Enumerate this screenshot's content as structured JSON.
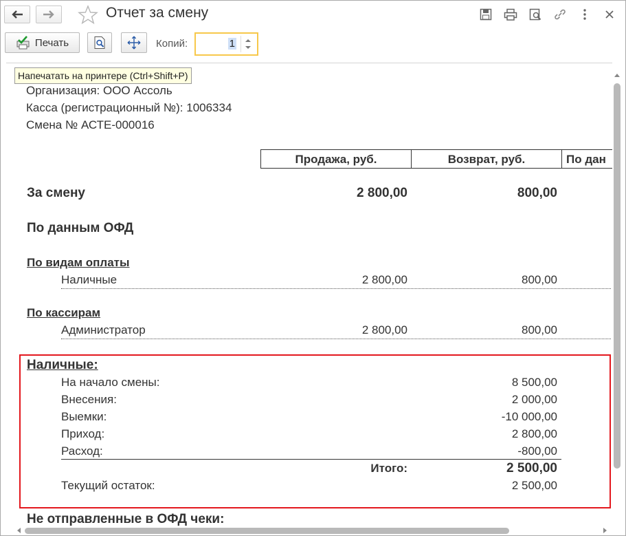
{
  "window": {
    "title": "Отчет за смену"
  },
  "toolbar": {
    "print_label": "Печать",
    "copies_label": "Копий:",
    "copies_value": "1",
    "tooltip": "Напечатать на принтере (Ctrl+Shift+P)"
  },
  "report": {
    "organization": "Организация: ООО Ассоль",
    "register": "Касса (регистрационный №): 1006334",
    "shift": "Смена № АСТЕ-000016",
    "columns": [
      "Продажа, руб.",
      "Возврат, руб.",
      "По дан"
    ],
    "for_shift": {
      "label": "За смену",
      "sale": "2 800,00",
      "return": "800,00"
    },
    "ofd_heading": "По данным ОФД",
    "by_payment": {
      "heading": "По видам оплаты",
      "rows": [
        {
          "label": "Наличные",
          "sale": "2 800,00",
          "return": "800,00"
        }
      ]
    },
    "by_cashier": {
      "heading": "По кассирам",
      "rows": [
        {
          "label": "Администратор",
          "sale": "2 800,00",
          "return": "800,00"
        }
      ]
    },
    "cash": {
      "heading": "Наличные:",
      "rows": [
        {
          "label": "На начало смены:",
          "value": "8 500,00"
        },
        {
          "label": "Внесения:",
          "value": "2 000,00"
        },
        {
          "label": "Выемки:",
          "value": "-10 000,00"
        },
        {
          "label": "Приход:",
          "value": "2 800,00"
        },
        {
          "label": "Расход:",
          "value": "-800,00"
        }
      ],
      "total_label": "Итого:",
      "total_value": "2 500,00",
      "balance_label": "Текущий остаток:",
      "balance_value": "2 500,00"
    },
    "unsent_heading": "Не отправленные в ОФД чеки:"
  },
  "colors": {
    "highlight_border": "#e3171d",
    "copies_focus": "#f7c84a",
    "tooltip_bg": "#ffffe1"
  },
  "icons": [
    "back-arrow-icon",
    "forward-arrow-icon",
    "star-icon",
    "save-icon",
    "print-icon",
    "preview-icon",
    "link-icon",
    "more-icon",
    "close-icon",
    "printer-check-icon",
    "page-preview-icon",
    "fit-page-icon"
  ]
}
